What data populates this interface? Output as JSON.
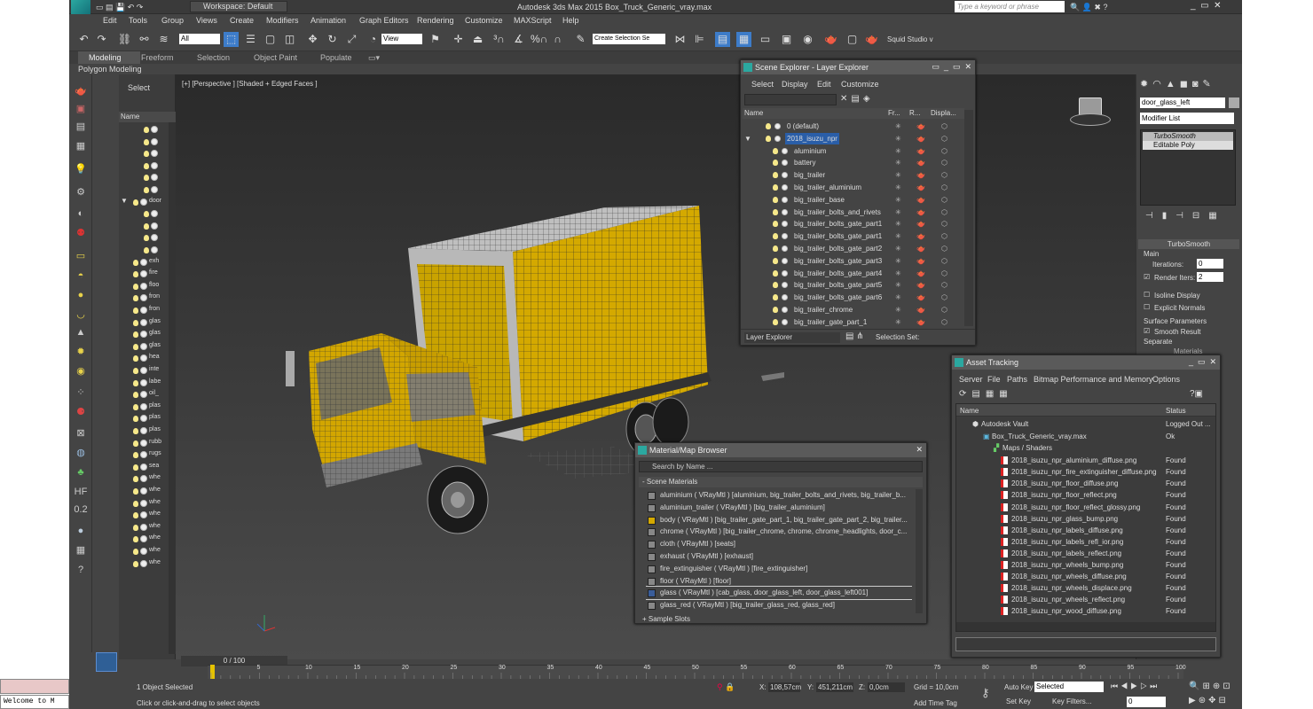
{
  "titlebar": {
    "workspace": "Workspace: Default",
    "app_title": "Autodesk 3ds Max 2015   Box_Truck_Generic_vray.max",
    "search_placeholder": "Type a keyword or phrase"
  },
  "menu": [
    "Edit",
    "Tools",
    "Group",
    "Views",
    "Create",
    "Modifiers",
    "Animation",
    "Graph Editors",
    "Rendering",
    "Customize",
    "MAXScript",
    "Help"
  ],
  "toolbar": {
    "filter": "All",
    "view": "View",
    "selection_set": "Create Selection Se",
    "studio": "Squid Studio v"
  },
  "ribbon": {
    "tabs": [
      "Modeling",
      "Freeform",
      "Selection",
      "Object Paint",
      "Populate"
    ],
    "sub": "Polygon Modeling"
  },
  "scene_panel": {
    "select": "Select",
    "name_col": "Name",
    "rows": [
      "",
      "",
      "",
      "",
      "",
      "",
      "door",
      "",
      "",
      "",
      "",
      "exh",
      "fire",
      "floo",
      "fron",
      "fron",
      "glas",
      "glas",
      "glas",
      "hea",
      "inte",
      "labe",
      "oil_",
      "plas",
      "plas",
      "plas",
      "rubb",
      "rugs",
      "sea",
      "whe",
      "whe",
      "whe",
      "whe",
      "whe",
      "whe",
      "whe",
      "whe"
    ]
  },
  "viewport": {
    "label": "[+] [Perspective ] [Shaded + Edged Faces ]"
  },
  "layer_explorer": {
    "title": "Scene Explorer - Layer Explorer",
    "menu": [
      "Select",
      "Display",
      "Edit",
      "Customize"
    ],
    "cols": [
      "Name",
      "Fr...",
      "R...",
      "Displa..."
    ],
    "rows": [
      "0 (default)",
      "2018_isuzu_npr",
      "aluminium",
      "battery",
      "big_trailer",
      "big_trailer_aluminium",
      "big_trailer_base",
      "big_trailer_bolts_and_rivets",
      "big_trailer_bolts_gate_part1",
      "big_trailer_bolts_gate_part1",
      "big_trailer_bolts_gate_part2",
      "big_trailer_bolts_gate_part3",
      "big_trailer_bolts_gate_part4",
      "big_trailer_bolts_gate_part5",
      "big_trailer_bolts_gate_part6",
      "big_trailer_chrome",
      "big_trailer_gate_part_1"
    ],
    "footer": "Layer Explorer",
    "selection_set": "Selection Set:"
  },
  "material_browser": {
    "title": "Material/Map Browser",
    "search": "Search by Name ...",
    "section": "- Scene Materials",
    "footer": "+ Sample Slots",
    "rows": [
      "aluminium ( VRayMtl ) [aluminium, big_trailer_bolts_and_rivets, big_trailer_b...",
      "aluminium_trailer ( VRayMtl ) [big_trailer_aluminium]",
      "body ( VRayMtl ) [big_trailer_gate_part_1, big_trailer_gate_part_2, big_trailer...",
      "chrome ( VRayMtl ) [big_trailer_chrome, chrome, chrome_headlights, door_c...",
      "cloth ( VRayMtl ) [seats]",
      "exhaust ( VRayMtl ) [exhaust]",
      "fire_extinguisher ( VRayMtl ) [fire_extinguisher]",
      "floor ( VRayMtl ) [floor]",
      "glass ( VRayMtl ) [cab_glass, door_glass_left, door_glass_left001]",
      "glass_red ( VRayMtl ) [big_trailer_glass_red, glass_red]"
    ]
  },
  "asset_tracking": {
    "title": "Asset Tracking",
    "menu": [
      "Server",
      "File",
      "Paths",
      "Bitmap Performance and Memory",
      "Options"
    ],
    "cols": [
      "Name",
      "Status"
    ],
    "vault": "Autodesk Vault",
    "vault_status": "Logged Out ...",
    "file": "Box_Truck_Generic_vray.max",
    "file_status": "Ok",
    "maps": "Maps / Shaders",
    "items": [
      "2018_isuzu_npr_aluminium_diffuse.png",
      "2018_isuzu_npr_fire_extinguisher_diffuse.png",
      "2018_isuzu_npr_floor_diffuse.png",
      "2018_isuzu_npr_floor_reflect.png",
      "2018_isuzu_npr_floor_reflect_glossy.png",
      "2018_isuzu_npr_glass_bump.png",
      "2018_isuzu_npr_labels_diffuse.png",
      "2018_isuzu_npr_labels_refl_ior.png",
      "2018_isuzu_npr_labels_reflect.png",
      "2018_isuzu_npr_wheels_bump.png",
      "2018_isuzu_npr_wheels_diffuse.png",
      "2018_isuzu_npr_wheels_displace.png",
      "2018_isuzu_npr_wheels_reflect.png",
      "2018_isuzu_npr_wood_diffuse.png"
    ],
    "item_status": "Found"
  },
  "command_panel": {
    "object": "door_glass_left",
    "modifier_list": "Modifier List",
    "stack": [
      "TurboSmooth",
      "Editable Poly"
    ],
    "rollout": "TurboSmooth",
    "main": "Main",
    "iterations_label": "Iterations:",
    "iterations": "0",
    "render_iters_label": "Render Iters:",
    "render_iters": "2",
    "isoline": "Isoline Display",
    "explicit": "Explicit Normals",
    "surface": "Surface Parameters",
    "smooth": "Smooth Result",
    "separate": "Separate",
    "materials": "Materials"
  },
  "status": {
    "timeline": "0 / 100",
    "selected": "1 Object Selected",
    "prompt": "Click or click-and-drag to select objects",
    "x": "108,57cm",
    "y": "451,211cm",
    "z": "0,0cm",
    "grid": "Grid = 10,0cm",
    "add_time_tag": "Add Time Tag",
    "auto_key": "Auto Key",
    "set_key": "Set Key",
    "selected_dd": "Selected",
    "key_filters": "Key Filters...",
    "frame": "0",
    "welcome": "Welcome to M",
    "ticks": [
      "5",
      "10",
      "15",
      "20",
      "25",
      "30",
      "35",
      "40",
      "45",
      "50",
      "55",
      "60",
      "65",
      "70",
      "75",
      "80",
      "85",
      "90",
      "95",
      "100"
    ]
  },
  "colors": {
    "truck_yellow": "#d4a900",
    "panel": "#444444",
    "highlight": "#2a5ea8"
  }
}
